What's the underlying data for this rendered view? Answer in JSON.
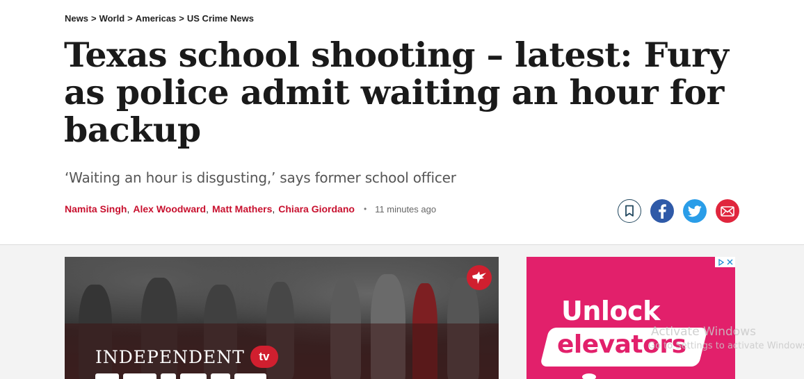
{
  "breadcrumb": [
    "News",
    "World",
    "Americas",
    "US Crime News"
  ],
  "breadcrumb_sep": ">",
  "headline": "Texas school shooting – latest: Fury as police admit waiting an hour for backup",
  "standfirst": "‘Waiting an hour is disgusting,’ says former school officer",
  "authors": [
    "Namita Singh",
    "Alex Woodward",
    "Matt Mathers",
    "Chiara Giordano"
  ],
  "published": "11 minutes ago",
  "share": {
    "icons": [
      "bookmark-icon",
      "facebook-icon",
      "twitter-icon",
      "email-icon"
    ],
    "colors": {
      "bookmark": "#22485f",
      "facebook": "#2f5aa8",
      "twitter": "#2a9de8",
      "email": "#e0263d"
    }
  },
  "video": {
    "brand": "INDEPENDENT",
    "brand_badge": "tv",
    "accent": "#d01f2f"
  },
  "ad": {
    "line1": "Unlock",
    "line2": "elevators",
    "background": "#e2206b"
  },
  "watermark": {
    "line1": "Activate Windows",
    "line2": "Go to Settings to activate Windows."
  }
}
